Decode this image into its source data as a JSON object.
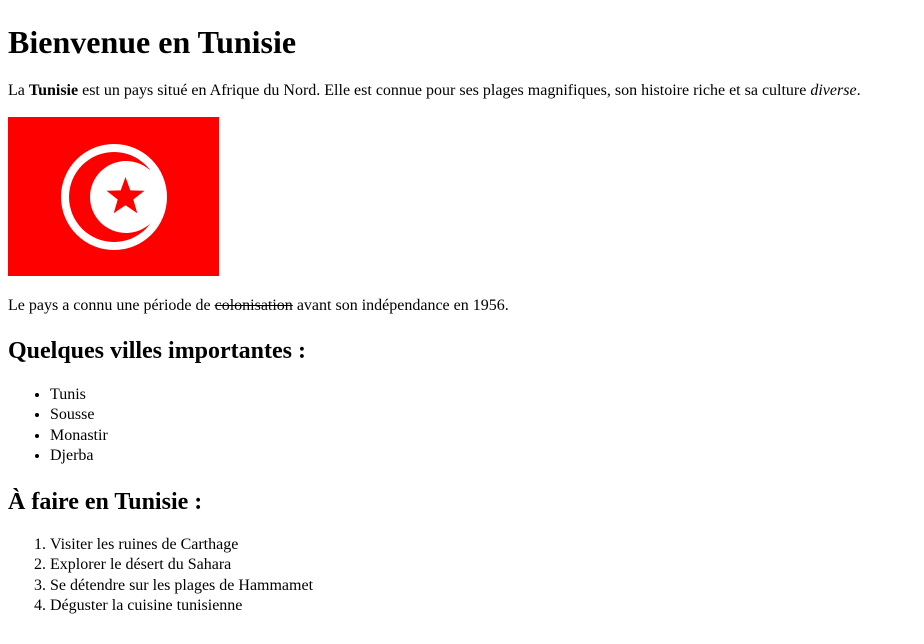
{
  "page": {
    "title": "Bienvenue en Tunisie"
  },
  "intro": {
    "prefix": "La ",
    "bold": "Tunisie",
    "middle": " est un pays situé en Afrique du Nord. Elle est connue pour ses plages magnifiques, son histoire riche et sa culture ",
    "italic": "diverse",
    "suffix": "."
  },
  "flag": {
    "icon": "tunisia-flag-icon",
    "background_color": "#ff0000",
    "circle_color": "#ffffff",
    "emblem_color": "#ff0000"
  },
  "history": {
    "prefix": "Le pays a connu une période de ",
    "struck": "colonisation",
    "suffix": " avant son indépendance en 1956."
  },
  "cities": {
    "heading": "Quelques villes importantes :",
    "items": [
      "Tunis",
      "Sousse",
      "Monastir",
      "Djerba"
    ]
  },
  "todo": {
    "heading": "À faire en Tunisie :",
    "items": [
      "Visiter les ruines de Carthage",
      "Explorer le désert du Sahara",
      "Se détendre sur les plages de Hammamet",
      "Déguster la cuisine tunisienne"
    ]
  }
}
